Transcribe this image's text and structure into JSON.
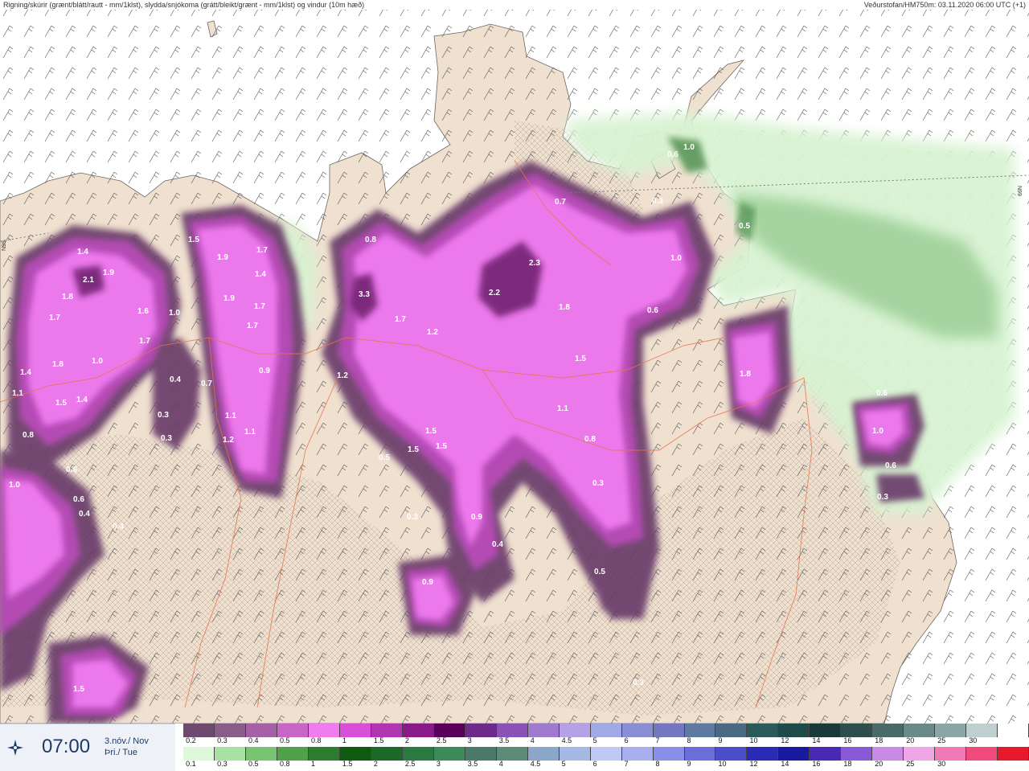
{
  "header": {
    "left_title": "Rigning/skúrir (grænt/blátt/rautt - mm/1klst), slydda/snjókoma (grátt/bleikt/grænt - mm/1klst) og vindur (10m hæð)",
    "right_title": "Veðurstofan/HM750m: 03.11.2020 06:00 UTC (+1)"
  },
  "map": {
    "edge_label_left": "N99",
    "edge_label_right": "N99",
    "colors": {
      "land": "#efe0cf",
      "sea": "#ffffff",
      "roads": "#e8724a",
      "snow_light": "#f08cf0",
      "snow_mid": "#c060c0",
      "snow_dark": "#6a3d6a",
      "rain_light": "#d8f3d2",
      "rain_mid": "#9ccf96",
      "rain_dark": "#4c8a4c"
    },
    "values": [
      {
        "t": "1.4"
      },
      {
        "t": "2.1"
      },
      {
        "t": "1.9"
      },
      {
        "t": "1.8"
      },
      {
        "t": "1.7"
      },
      {
        "t": "1.6"
      },
      {
        "t": "1.0"
      },
      {
        "t": "1.7"
      },
      {
        "t": "1.4"
      },
      {
        "t": "1.8"
      },
      {
        "t": "1.0"
      },
      {
        "t": "1.1"
      },
      {
        "t": "1.5"
      },
      {
        "t": "1.4"
      },
      {
        "t": "0.8"
      },
      {
        "t": "0.4"
      },
      {
        "t": "0.7"
      },
      {
        "t": "0.3"
      },
      {
        "t": "0.3"
      },
      {
        "t": "1.5"
      },
      {
        "t": "1.9"
      },
      {
        "t": "1.7"
      },
      {
        "t": "1.4"
      },
      {
        "t": "1.9"
      },
      {
        "t": "1.7"
      },
      {
        "t": "1.7"
      },
      {
        "t": "0.9"
      },
      {
        "t": "1.1"
      },
      {
        "t": "1.1"
      },
      {
        "t": "1.2"
      },
      {
        "t": "0.8"
      },
      {
        "t": "3.3"
      },
      {
        "t": "1.7"
      },
      {
        "t": "1.2"
      },
      {
        "t": "1.2"
      },
      {
        "t": "0.7"
      },
      {
        "t": "2.3"
      },
      {
        "t": "2.2"
      },
      {
        "t": "1.8"
      },
      {
        "t": "1.0"
      },
      {
        "t": "0.6"
      },
      {
        "t": "1.5"
      },
      {
        "t": "1.1"
      },
      {
        "t": "0.8"
      },
      {
        "t": "1.5"
      },
      {
        "t": "1.5"
      },
      {
        "t": "1.5"
      },
      {
        "t": "0.5"
      },
      {
        "t": "0.3"
      },
      {
        "t": "0.9"
      },
      {
        "t": "0.3"
      },
      {
        "t": "0.4"
      },
      {
        "t": "0.9"
      },
      {
        "t": "0.5"
      },
      {
        "t": "1.8"
      },
      {
        "t": "1.0"
      },
      {
        "t": "0.6"
      },
      {
        "t": "0.6"
      },
      {
        "t": "0.4"
      },
      {
        "t": "1.0"
      },
      {
        "t": "0.6"
      },
      {
        "t": "0.3"
      },
      {
        "t": "1.5"
      },
      {
        "t": "0.3"
      },
      {
        "t": "1.0"
      },
      {
        "t": "0.5"
      },
      {
        "t": "0.3"
      },
      {
        "t": "0.6"
      },
      {
        "t": "0.6"
      },
      {
        "t": "0.4"
      }
    ]
  },
  "time_panel": {
    "compass_icon": "compass-icon",
    "time": "07:00",
    "date_line1": "3.nóv./ Nov",
    "date_line2": "Þri./ Tue"
  },
  "legend": {
    "top_colors": [
      "#6e4a6e",
      "#8a5c8a",
      "#a660a6",
      "#c866c8",
      "#f07cf0",
      "#d94fd9",
      "#b236b2",
      "#8a1a8a",
      "#5a005a",
      "#6e2a8a",
      "#8a52b4",
      "#a07ad0",
      "#b6a0e6",
      "#a0a8e6",
      "#8a8ed6",
      "#7476c2",
      "#5e7aa0",
      "#4a6a84",
      "#2a5a5a",
      "#1f4a4a",
      "#1a3a3a",
      "#2e4e4e",
      "#4a6a6a",
      "#6a8a8a",
      "#8aa6a6",
      "#bfcfcf",
      "#ffffff"
    ],
    "top_ticks": [
      "0.2",
      "0.3",
      "0.4",
      "0.5",
      "0.8",
      "1",
      "1.5",
      "2",
      "2.5",
      "3",
      "3.5",
      "4",
      "4.5",
      "5",
      "6",
      "7",
      "8",
      "9",
      "10",
      "12",
      "14",
      "16",
      "18",
      "20",
      "25",
      "30"
    ],
    "bottom_colors": [
      "#dff7da",
      "#a9e0a3",
      "#78c472",
      "#4fa24a",
      "#2e7d2e",
      "#0f5a0f",
      "#1c6a2a",
      "#2a7a42",
      "#3a8a5a",
      "#4c7a6a",
      "#5e8a7a",
      "#8aa6c8",
      "#a6b8e6",
      "#c0c8f6",
      "#a8aef0",
      "#8a8ee6",
      "#6a6ed6",
      "#4a4ec8",
      "#2a2ab4",
      "#1a1aa0",
      "#4a2ab4",
      "#8a5ad6",
      "#c88ae6",
      "#f0a6e6",
      "#f07ab4",
      "#f04a7a",
      "#e61a2a"
    ],
    "bottom_ticks": [
      "0.1",
      "0.3",
      "0.5",
      "0.8",
      "1",
      "1.5",
      "2",
      "2.5",
      "3",
      "3.5",
      "4",
      "4.5",
      "5",
      "6",
      "7",
      "8",
      "9",
      "10",
      "12",
      "14",
      "16",
      "18",
      "20",
      "25",
      "30"
    ]
  }
}
